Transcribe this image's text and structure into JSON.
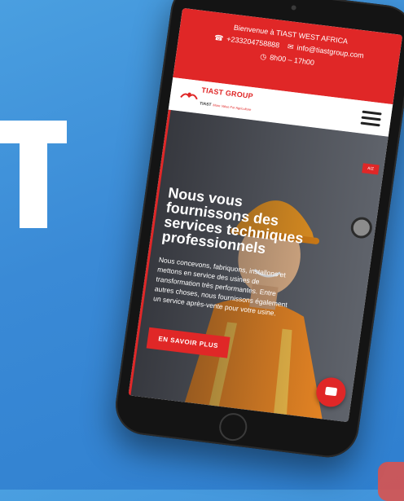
{
  "topbar": {
    "welcome": "Bienvenue à TIAST WEST AFRICA",
    "phone": "+233204758888",
    "email": "info@tiastgroup.com",
    "hours": "8h00 – 17h00"
  },
  "logo": {
    "name": "TIAST GROUP",
    "prefix": "TIAST",
    "tagline": "More Value For Agriculture"
  },
  "hero": {
    "title_line1": "Nous vous",
    "title_line2": "fournissons des",
    "title_line3": "services techniques",
    "title_line4": "professionnels",
    "desc_line1": "Nous concevons, fabriquons, installons et",
    "desc_line2": "mettons en service des usines de",
    "desc_line3": "transformation très performantes. Entre",
    "desc_line4": "autres choses, nous fournissons également",
    "desc_line5": "un service après-vente pour votre usine.",
    "cta_label": "EN SAVOIR PLUS",
    "lang_label": "A/Z"
  },
  "icons": {
    "phone": "phone-icon",
    "email": "envelope-icon",
    "clock": "clock-icon",
    "menu": "hamburger-menu-icon",
    "chat": "chat-bubble-icon"
  },
  "colors": {
    "brand_red": "#e02727",
    "background_blue": "#3a8ad6"
  }
}
